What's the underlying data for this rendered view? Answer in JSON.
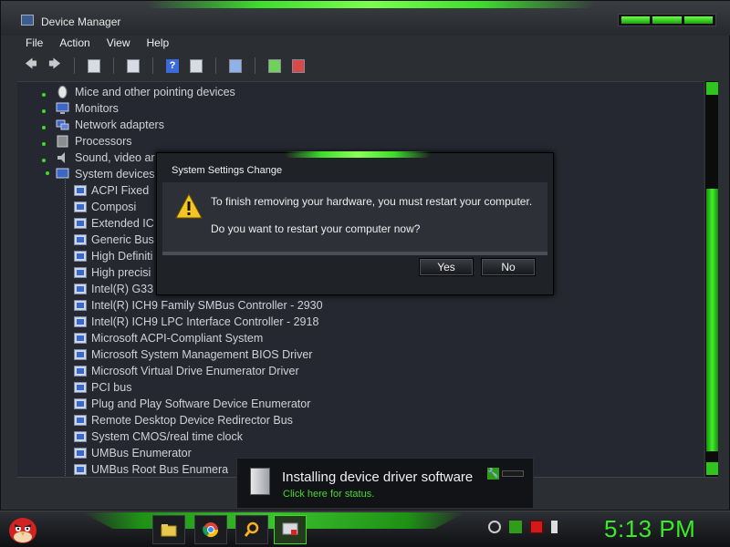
{
  "window": {
    "title": "Device Manager"
  },
  "menu": [
    "File",
    "Action",
    "View",
    "Help"
  ],
  "toolbar": {
    "icons": [
      "back-arrow-icon",
      "forward-arrow-icon",
      "show-hide-console-tree-icon",
      "properties-icon",
      "help-icon",
      "action-pane-icon",
      "scan-hardware-icon",
      "update-driver-icon",
      "uninstall-icon"
    ]
  },
  "tree": {
    "categories": [
      {
        "label": "Mice and other pointing devices",
        "icon": "mouse-icon"
      },
      {
        "label": "Monitors",
        "icon": "monitor-icon"
      },
      {
        "label": "Network adapters",
        "icon": "network-adapter-icon"
      },
      {
        "label": "Processors",
        "icon": "processor-icon"
      },
      {
        "label": "Sound, video ar",
        "icon": "sound-icon"
      },
      {
        "label": "System devices",
        "icon": "system-devices-icon"
      }
    ],
    "devices": [
      "ACPI Fixed",
      "Composi",
      "Extended IC",
      "Generic Bus",
      "High Definiti",
      "High precisi",
      "Intel(R) G33",
      "Intel(R) ICH9 Family SMBus Controller - 2930",
      "Intel(R) ICH9 LPC Interface Controller - 2918",
      "Microsoft ACPI-Compliant System",
      "Microsoft System Management BIOS Driver",
      "Microsoft Virtual Drive Enumerator Driver",
      "PCI bus",
      "Plug and Play Software Device Enumerator",
      "Remote Desktop Device Redirector Bus",
      "System CMOS/real time clock",
      "UMBus Enumerator",
      "UMBus Root Bus Enumera"
    ]
  },
  "dialog": {
    "title": "System Settings Change",
    "message1": "To finish removing your hardware, you must restart your computer.",
    "message2": "Do you want to restart your computer now?",
    "yes_label": "Yes",
    "no_label": "No",
    "icon": "warning-icon"
  },
  "notification": {
    "title": "Installing device driver software",
    "link": "Click here for status."
  },
  "taskbar": {
    "apps": [
      "file-explorer-icon",
      "chrome-icon",
      "search-icon",
      "device-manager-icon"
    ],
    "tray": [
      "network-icon",
      "action-center-icon",
      "flag-icon",
      "volume-icon"
    ],
    "clock": "5:13 PM"
  },
  "colors": {
    "accent": "#3ddc2c",
    "background": "#252830",
    "text": "#cfd2d7"
  }
}
